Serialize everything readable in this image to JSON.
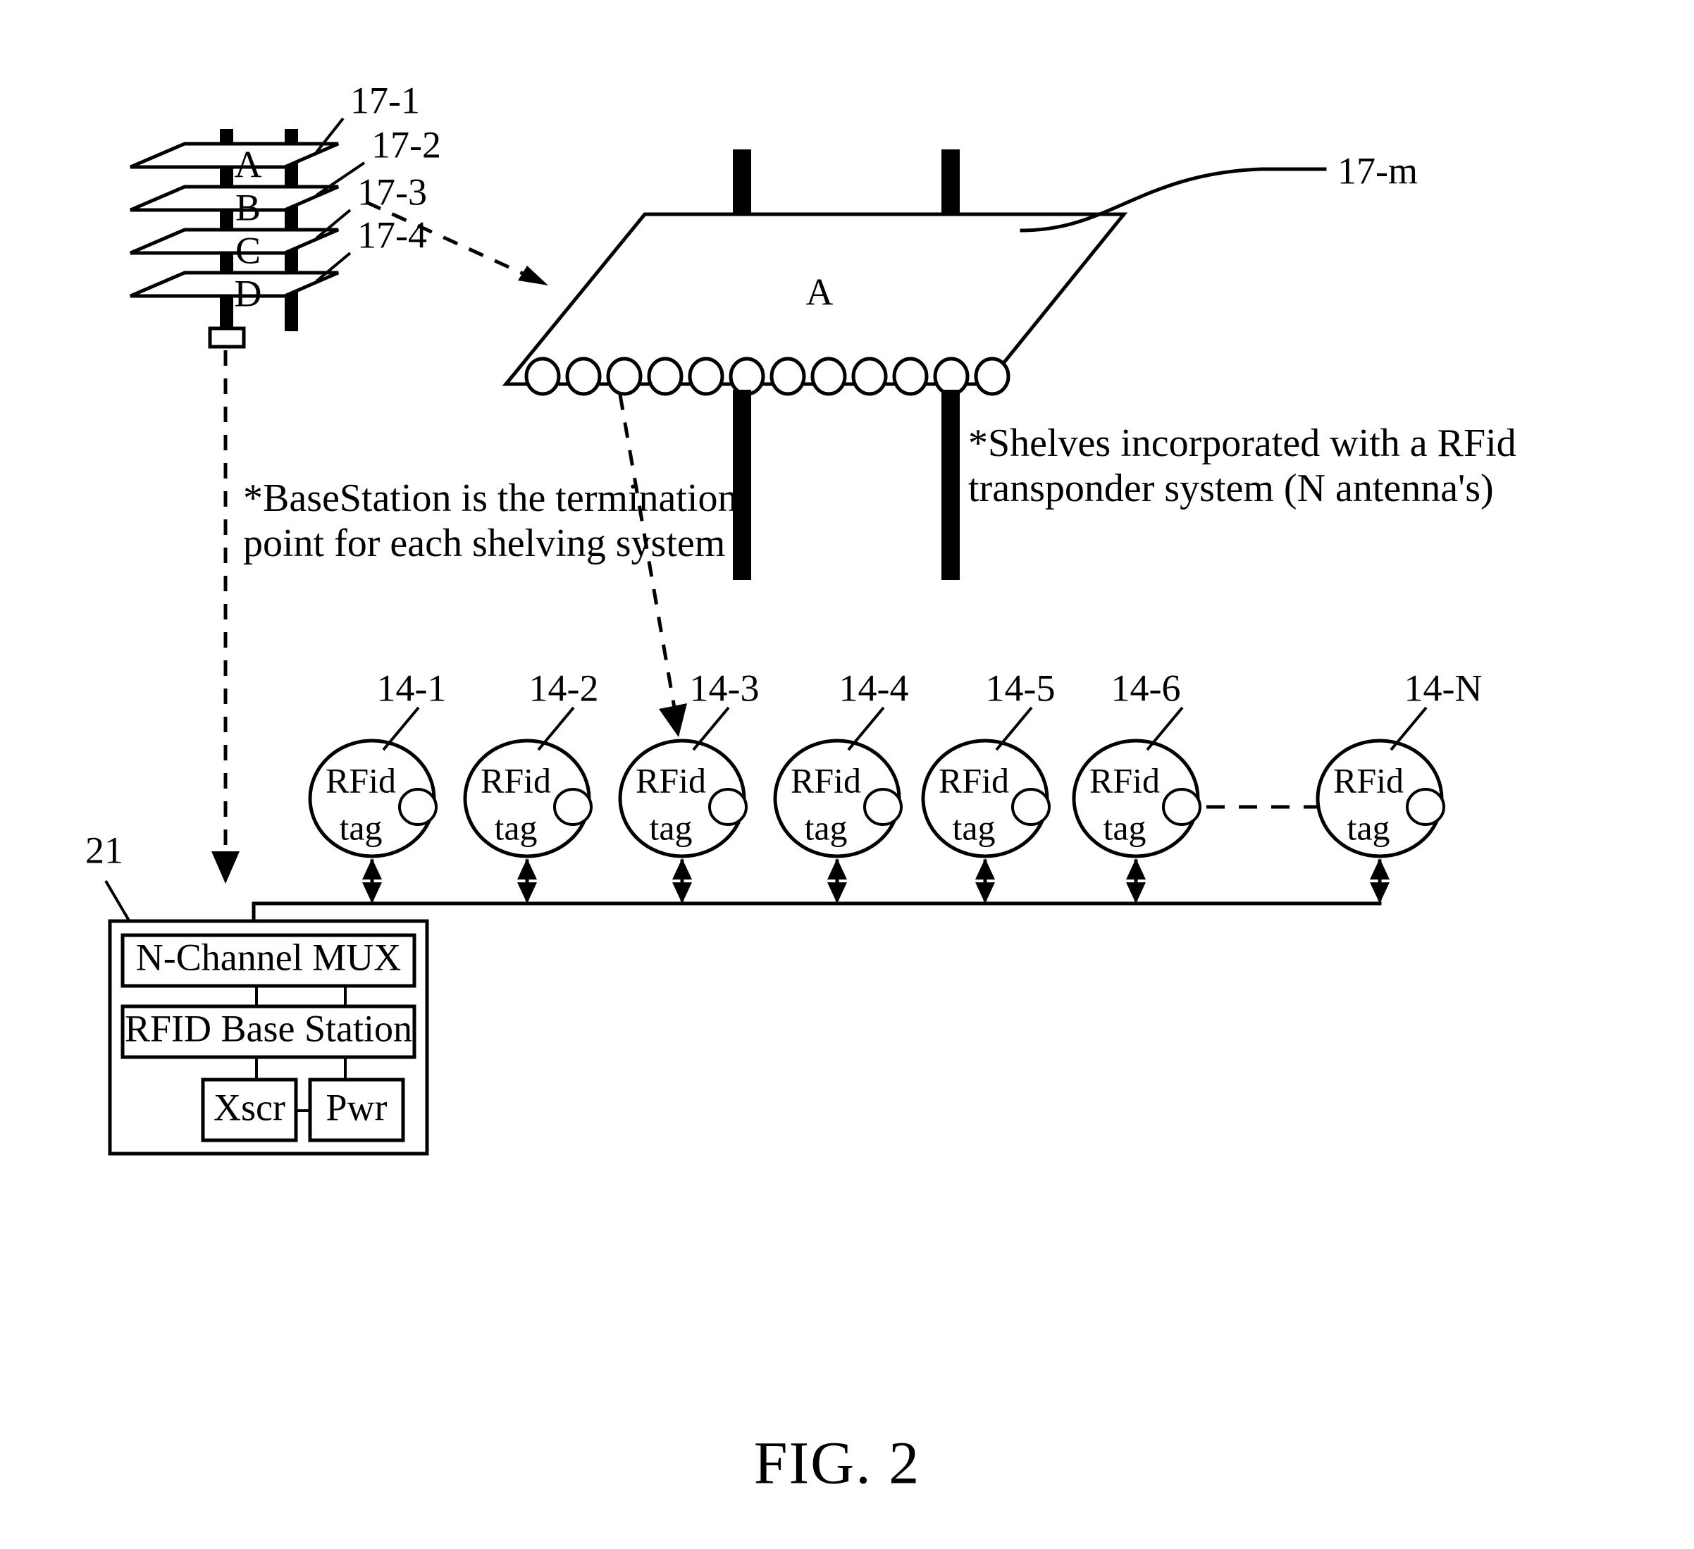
{
  "figure": {
    "caption": "FIG. 2"
  },
  "shelf_stack": {
    "shelves": [
      {
        "label": "A",
        "ref": "17-1"
      },
      {
        "label": "B",
        "ref": "17-2"
      },
      {
        "label": "C",
        "ref": "17-3"
      },
      {
        "label": "D",
        "ref": "17-4"
      }
    ],
    "termination_connector": "base-station-connector"
  },
  "large_shelf": {
    "label": "A",
    "ref": "17-m",
    "antenna_count": 12
  },
  "notes": {
    "basestation": {
      "line1": "*BaseStation is the termination",
      "line2": "point for each shelving system"
    },
    "shelves": {
      "line1": "*Shelves incorporated with a RFid",
      "line2": "transponder system (N antenna's)"
    }
  },
  "tags": {
    "label_line1": "RFid",
    "label_line2": "tag",
    "items": [
      {
        "ref": "14-1"
      },
      {
        "ref": "14-2"
      },
      {
        "ref": "14-3"
      },
      {
        "ref": "14-4"
      },
      {
        "ref": "14-5"
      },
      {
        "ref": "14-6"
      },
      {
        "ref": "14-N"
      }
    ]
  },
  "base_station": {
    "ref": "21",
    "mux": "N-Channel MUX",
    "station": "RFID Base Station",
    "xscr": "Xscr",
    "pwr": "Pwr"
  },
  "colors": {
    "ink": "#000000",
    "paper": "#ffffff"
  }
}
